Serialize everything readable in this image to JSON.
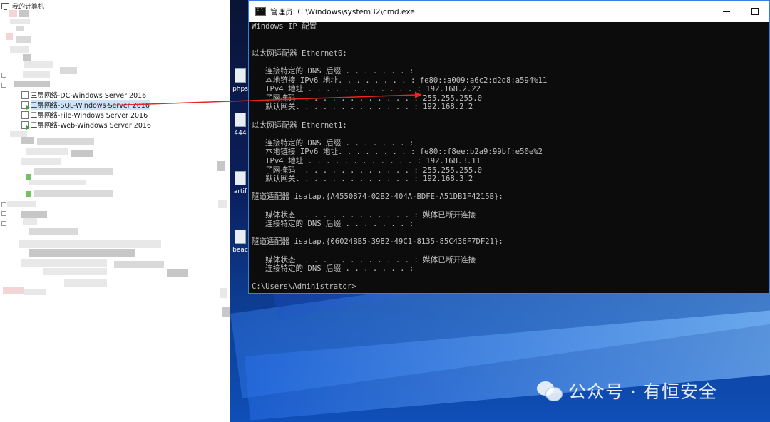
{
  "tree": {
    "root_label": "我的计算机",
    "vms": [
      {
        "label": "三层网络-DC-Windows Server 2016",
        "running": false,
        "selected": false
      },
      {
        "label": "三层网络-SQL-Windows Server 2016",
        "running": true,
        "selected": true
      },
      {
        "label": "三层网络-File-Windows Server 2016",
        "running": false,
        "selected": false
      },
      {
        "label": "三层网络-Web-Windows Server 2016",
        "running": true,
        "selected": false
      }
    ]
  },
  "desktop": {
    "icons": [
      {
        "label": "phps"
      },
      {
        "label": "444"
      },
      {
        "label": "artif"
      },
      {
        "label": "beac"
      }
    ]
  },
  "cmd": {
    "title": "管理员: C:\\Windows\\system32\\cmd.exe",
    "lines": [
      "Windows IP 配置",
      "",
      "",
      "以太网适配器 Ethernet0:",
      "",
      "   连接特定的 DNS 后缀 . . . . . . . :",
      "   本地链接 IPv6 地址. . . . . . . . : fe80::a009:a6c2:d2d8:a594%11",
      "   IPv4 地址 . . . . . . . . . . . . : 192.168.2.22",
      "   子网掩码  . . . . . . . . . . . . : 255.255.255.0",
      "   默认网关. . . . . . . . . . . . . : 192.168.2.2",
      "",
      "以太网适配器 Ethernet1:",
      "",
      "   连接特定的 DNS 后缀 . . . . . . . :",
      "   本地链接 IPv6 地址. . . . . . . . : fe80::f8ee:b2a9:99bf:e50e%2",
      "   IPv4 地址 . . . . . . . . . . . . : 192.168.3.11",
      "   子网掩码  . . . . . . . . . . . . : 255.255.255.0",
      "   默认网关. . . . . . . . . . . . . : 192.168.3.2",
      "",
      "隧道适配器 isatap.{A4550874-02B2-404A-BDFE-A51DB1F4215B}:",
      "",
      "   媒体状态  . . . . . . . . . . . . : 媒体已断开连接",
      "   连接特定的 DNS 后缀 . . . . . . . :",
      "",
      "隧道适配器 isatap.{06024BB5-3982-49C1-8135-85C436F7DF21}:",
      "",
      "   媒体状态  . . . . . . . . . . . . : 媒体已断开连接",
      "   连接特定的 DNS 后缀 . . . . . . . :",
      "",
      "C:\\Users\\Administrator>"
    ]
  },
  "watermark": {
    "text": "公众号 · 有恒安全",
    "icon": "wechat-icon"
  },
  "colors": {
    "annotation_arrow": "#e8261e",
    "console_bg": "#0c0c0c",
    "console_text": "#c0c0c0",
    "selection": "#cde3f7",
    "running_green": "#3ca43c"
  }
}
